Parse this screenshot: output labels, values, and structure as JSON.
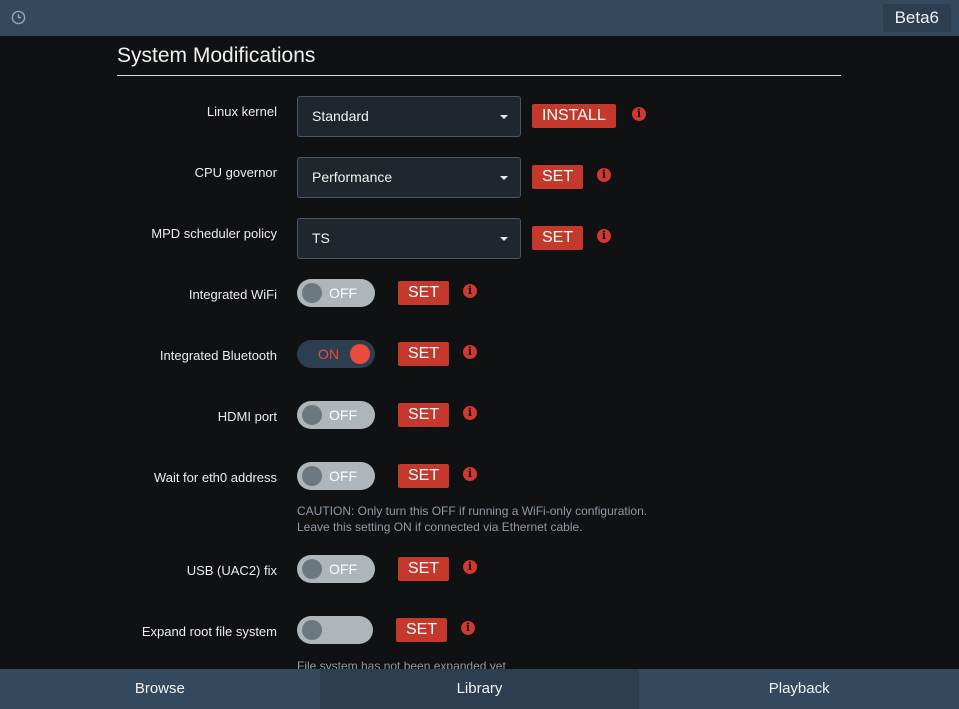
{
  "header": {
    "version_label": "Beta6"
  },
  "section": {
    "title": "System Modifications"
  },
  "settings": {
    "linux_kernel": {
      "label": "Linux kernel",
      "value": "Standard",
      "button": "INSTALL"
    },
    "cpu_governor": {
      "label": "CPU governor",
      "value": "Performance",
      "button": "SET"
    },
    "mpd_scheduler": {
      "label": "MPD scheduler policy",
      "value": "TS",
      "button": "SET"
    },
    "wifi": {
      "label": "Integrated WiFi",
      "state": "OFF",
      "button": "SET"
    },
    "bluetooth": {
      "label": "Integrated Bluetooth",
      "state": "ON",
      "button": "SET"
    },
    "hdmi": {
      "label": "HDMI port",
      "state": "OFF",
      "button": "SET"
    },
    "eth0": {
      "label": "Wait for eth0 address",
      "state": "OFF",
      "button": "SET",
      "note_line1": "CAUTION: Only turn this OFF if running a WiFi-only configuration.",
      "note_line2": "Leave this setting ON if connected via Ethernet cable."
    },
    "usb_fix": {
      "label": "USB (UAC2) fix",
      "state": "OFF",
      "button": "SET"
    },
    "expand_fs": {
      "label": "Expand root file system",
      "state": "",
      "button": "SET",
      "note_line1": "File system has not been expanded yet"
    }
  },
  "icons": {
    "info_glyph": "i",
    "clock": "clock-icon",
    "caret": "chevron-down-icon"
  },
  "nav": {
    "tabs": [
      "Browse",
      "Library",
      "Playback"
    ]
  },
  "colors": {
    "accent": "#c5382c",
    "header_bg": "#34495e",
    "toggle_on": "#e74c3c"
  }
}
